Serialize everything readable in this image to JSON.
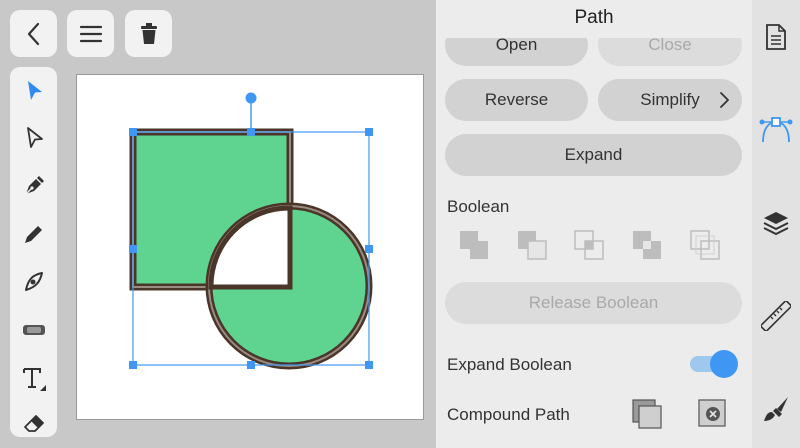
{
  "panel": {
    "title": "Path",
    "buttons": {
      "open": "Open",
      "close": "Close",
      "reverse": "Reverse",
      "simplify": "Simplify",
      "expand": "Expand",
      "release_boolean": "Release Boolean"
    },
    "boolean_label": "Boolean",
    "expand_boolean_label": "Expand Boolean",
    "expand_boolean_on": true,
    "compound_path_label": "Compound Path"
  },
  "colors": {
    "accent": "#3f97f3",
    "shape_fill": "#5fd491",
    "shape_stroke": "#4a3528",
    "selection": "#3f97f3"
  },
  "icons": {
    "top": [
      "chevron-left-icon",
      "menu-icon",
      "trash-icon"
    ],
    "tools": [
      "move-tool-icon",
      "node-tool-icon",
      "pen-tool-icon",
      "pencil-tool-icon",
      "vector-brush-icon",
      "fill-tool-icon",
      "text-tool-icon",
      "eraser-icon"
    ],
    "right": [
      "document-icon",
      "path-studio-icon",
      "layers-icon",
      "transform-icon",
      "brush-icon"
    ]
  }
}
